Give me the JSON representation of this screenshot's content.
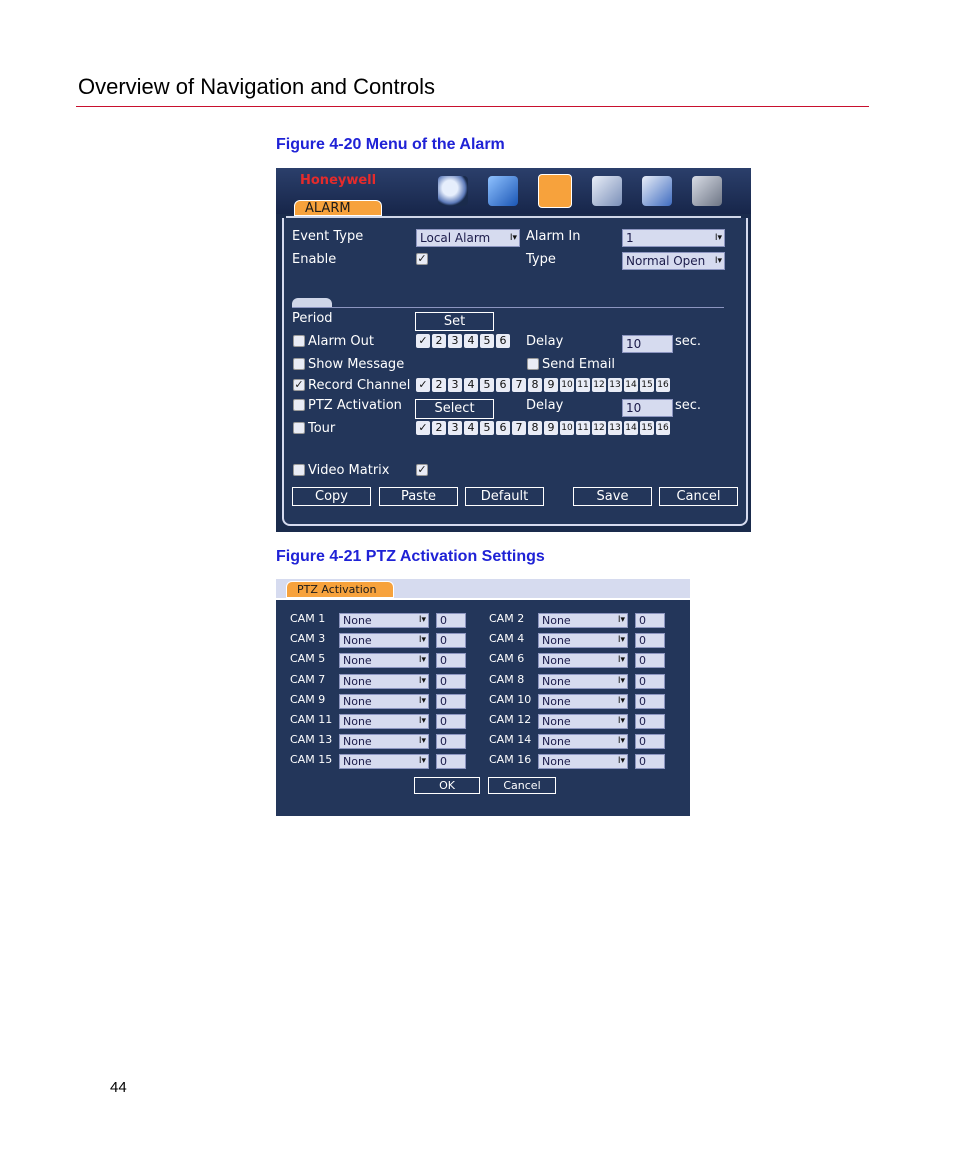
{
  "header": {
    "title": "Overview of Navigation and Controls"
  },
  "figure1": {
    "caption": "Figure 4-20 Menu of the Alarm",
    "logo": "Honeywell",
    "tab": "ALARM",
    "event_type_label": "Event Type",
    "event_type_value": "Local Alarm",
    "alarm_in_label": "Alarm In",
    "alarm_in_value": "1",
    "enable_label": "Enable",
    "type_label": "Type",
    "type_value": "Normal Open",
    "period_label": "Period",
    "set_label": "Set",
    "alarm_out_label": "Alarm Out",
    "delay_label": "Delay",
    "delay_value": "10",
    "sec_label": "sec.",
    "show_message_label": "Show Message",
    "send_email_label": "Send Email",
    "record_channel_label": "Record Channel",
    "ptz_activation_label": "PTZ Activation",
    "select_label": "Select",
    "delay2_label": "Delay",
    "delay2_value": "10",
    "sec2_label": "sec.",
    "tour_label": "Tour",
    "video_matrix_label": "Video Matrix",
    "alarm_out_nums": [
      "2",
      "3",
      "4",
      "5",
      "6"
    ],
    "channel_nums": [
      "2",
      "3",
      "4",
      "5",
      "6",
      "7",
      "8",
      "9",
      "10",
      "11",
      "12",
      "13",
      "14",
      "15",
      "16"
    ],
    "buttons": {
      "copy": "Copy",
      "paste": "Paste",
      "default": "Default",
      "save": "Save",
      "cancel": "Cancel"
    },
    "icons": [
      "search-icon",
      "info-icon",
      "setting-icon",
      "advanced-icon",
      "backup-icon",
      "shutdown-icon"
    ]
  },
  "figure2": {
    "caption": "Figure 4-21 PTZ Activation Settings",
    "tab": "PTZ Activation",
    "cams": [
      {
        "left": "CAM 1",
        "right": "CAM 2"
      },
      {
        "left": "CAM 3",
        "right": "CAM 4"
      },
      {
        "left": "CAM 5",
        "right": "CAM 6"
      },
      {
        "left": "CAM 7",
        "right": "CAM 8"
      },
      {
        "left": "CAM 9",
        "right": "CAM 10"
      },
      {
        "left": "CAM 11",
        "right": "CAM 12"
      },
      {
        "left": "CAM 13",
        "right": "CAM 14"
      },
      {
        "left": "CAM 15",
        "right": "CAM 16"
      }
    ],
    "none_label": "None",
    "zero_value": "0",
    "ok_label": "OK",
    "cancel_label": "Cancel"
  },
  "page_number": "44"
}
